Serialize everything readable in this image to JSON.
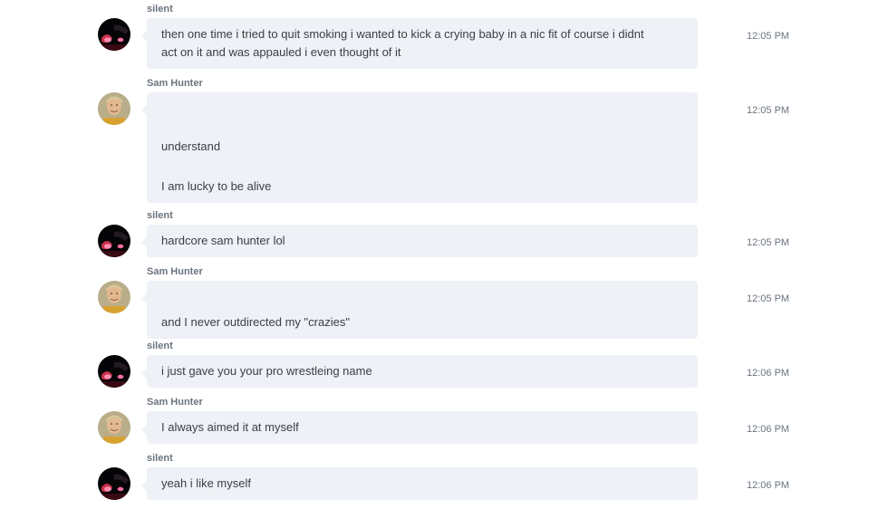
{
  "messages": [
    {
      "sender": "silent",
      "time": "12:05 PM",
      "lines": [
        "then one time i tried to quit smoking i wanted to kick a crying baby in a nic fit of course i didnt",
        "act on it and was appauled i even thought of it"
      ]
    },
    {
      "sender": "Sam Hunter",
      "time": "12:05 PM",
      "lines": [
        "",
        "",
        "understand",
        "",
        "I am lucky to be alive"
      ]
    },
    {
      "sender": "silent",
      "time": "12:05 PM",
      "lines": [
        "hardcore sam hunter lol"
      ]
    },
    {
      "sender": "Sam Hunter",
      "time": "12:05 PM",
      "lines": [
        "",
        "and I never outdirected my \"crazies\""
      ]
    },
    {
      "sender": "silent",
      "time": "12:06 PM",
      "lines": [
        "i just gave you your pro wrestleing name"
      ]
    },
    {
      "sender": "Sam Hunter",
      "time": "12:06 PM",
      "lines": [
        "I always aimed it at myself"
      ]
    },
    {
      "sender": "silent",
      "time": "12:06 PM",
      "lines": [
        "yeah i like myself"
      ]
    }
  ],
  "colors": {
    "bubble": "#eef1f6",
    "text": "#3a3f45",
    "meta": "#6b747e"
  }
}
